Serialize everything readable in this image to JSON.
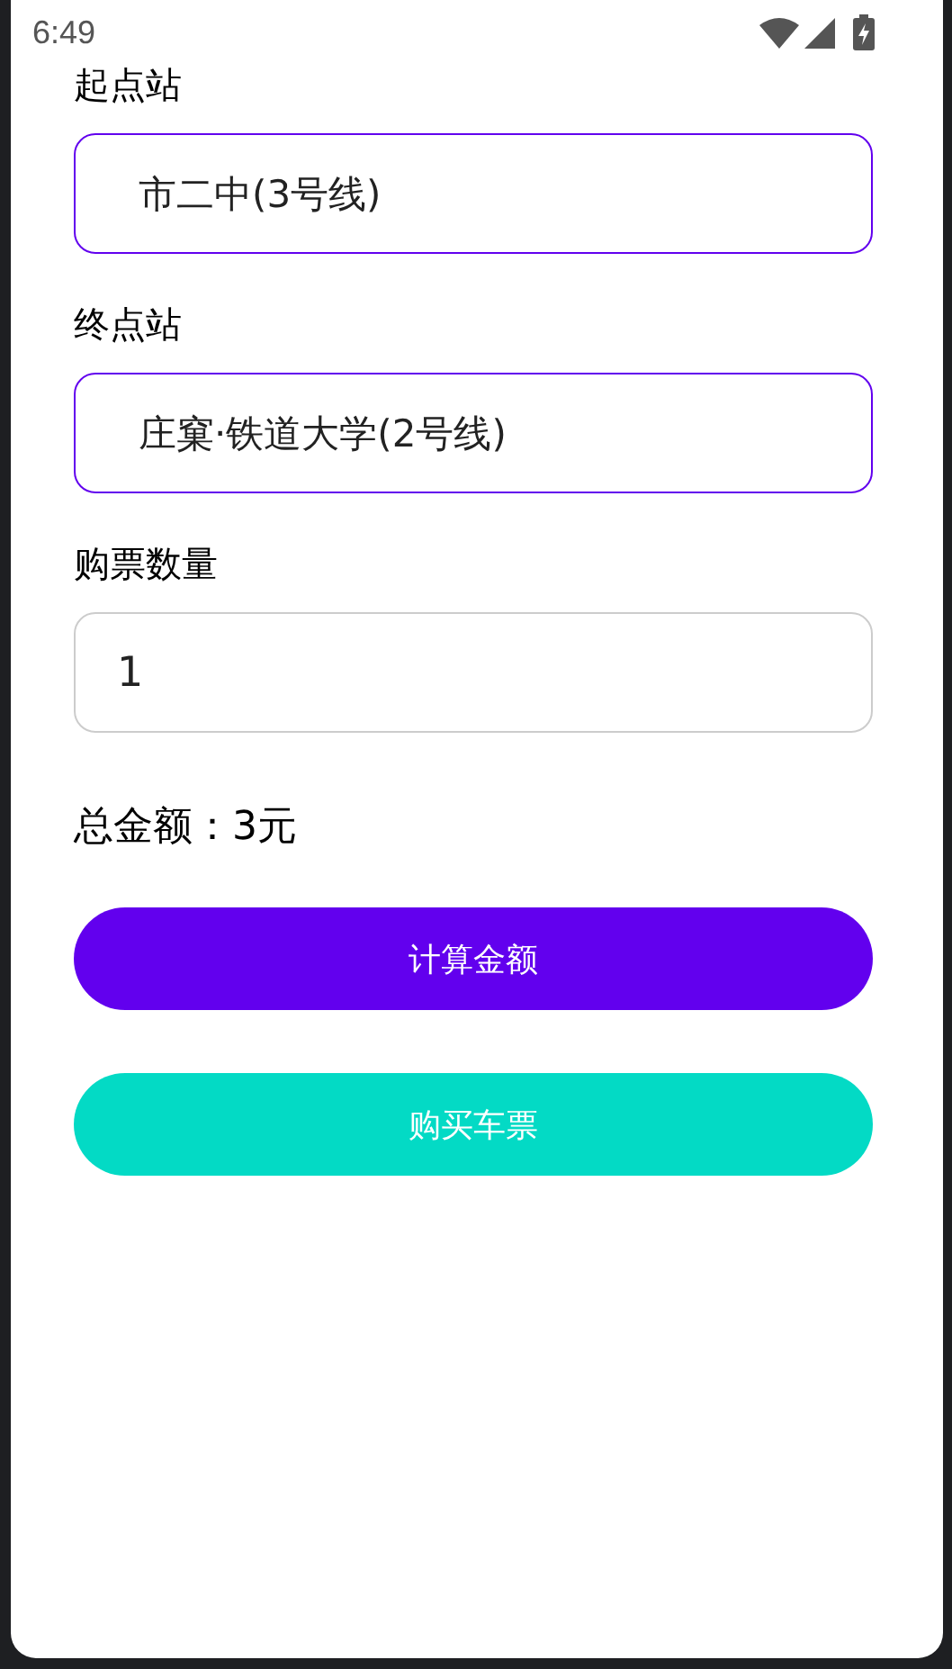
{
  "status_bar": {
    "time": "6:49"
  },
  "fields": [
    {
      "label": "起点站",
      "kind": "select",
      "value": "市二中(3号线)"
    },
    {
      "label": "终点站",
      "kind": "select",
      "value": "庄窠·铁道大学(2号线)"
    },
    {
      "label": "购票数量",
      "kind": "input",
      "value": "1"
    }
  ],
  "total": "总金额：3元",
  "buttons": [
    {
      "label": "计算金额",
      "color": "#6200ee"
    },
    {
      "label": "购买车票",
      "color": "#03dac5"
    }
  ]
}
